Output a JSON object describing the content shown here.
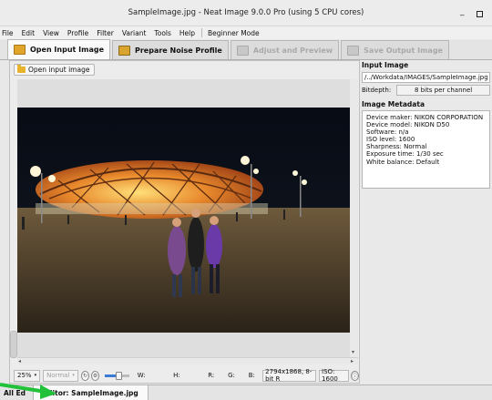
{
  "window": {
    "title": "SampleImage.jpg - Neat Image 9.0.0 Pro (using 5 CPU cores)",
    "minimize": "_"
  },
  "menubar": {
    "items": [
      "File",
      "Edit",
      "View",
      "Profile",
      "Filter",
      "Variant",
      "Tools",
      "Help"
    ],
    "extra": "Beginner Mode"
  },
  "workflow_tabs": [
    {
      "label": "Open Input Image",
      "icon": "open-image-icon",
      "color": "#e0a52a"
    },
    {
      "label": "Prepare Noise Profile",
      "icon": "noise-profile-icon",
      "color": "#d9a52f"
    },
    {
      "label": "Adjust and Preview",
      "icon": "adjust-preview-icon",
      "color": "#bdbdbd"
    },
    {
      "label": "Save Output Image",
      "icon": "save-output-icon",
      "color": "#bdbdbd"
    }
  ],
  "left_panel": {
    "open_button": "Open input image"
  },
  "statusbar": {
    "zoom": "25%",
    "mode": "Normal",
    "w_label": "W:",
    "h_label": "H:",
    "r_label": "R:",
    "g_label": "G:",
    "b_label": "B:",
    "image_info": "2794x1868, 8-bit R",
    "iso": "ISO: 1600",
    "zoom_slider_level": 0.55
  },
  "right_panel": {
    "input_title": "Input Image",
    "path": "/../Workdata/IMAGES/SampleImage.jpg",
    "bitdepth_label": "Bitdepth:",
    "bitdepth_value": "8 bits per channel",
    "metadata_title": "Image Metadata",
    "metadata": [
      "Device maker: NIKON CORPORATION",
      "Device model: NIKON D50",
      "Software: n/a",
      "ISO level: 1600",
      "Sharpness: Normal",
      "Exposure time: 1/30 sec",
      "White balance: Default"
    ]
  },
  "bottom_tabs": {
    "all": "All Ed",
    "editor": "Editor: SampleImage.jpg"
  },
  "colors": {
    "accent_arrow": "#21c13a",
    "slider": "#3a7bd5"
  }
}
